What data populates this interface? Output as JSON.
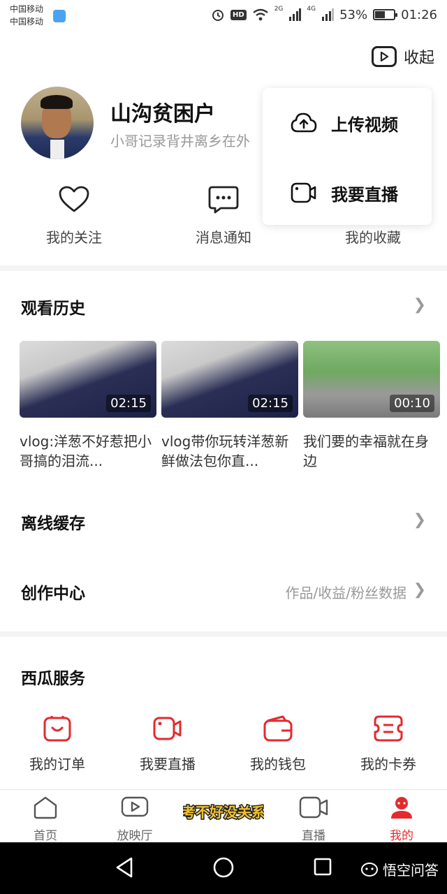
{
  "status_bar": {
    "carrier_1": "中国移动",
    "carrier_2": "中国移动",
    "hd": "HD",
    "net_1": "2G",
    "net_2": "4G",
    "battery": "53%",
    "battery_level": 0.53,
    "time": "01:26"
  },
  "header": {
    "collapse_label": "收起"
  },
  "profile": {
    "name": "山沟贫困户",
    "bio": "小哥记录背井离乡在外"
  },
  "popup_menu": {
    "upload": "上传视频",
    "live": "我要直播"
  },
  "quick_actions": [
    {
      "label": "我的关注",
      "icon": "heart-icon"
    },
    {
      "label": "消息通知",
      "icon": "message-icon"
    },
    {
      "label": "我的收藏",
      "icon": "star-icon"
    }
  ],
  "history": {
    "title": "观看历史",
    "items": [
      {
        "title": "vlog:洋葱不好惹把小哥搞的泪流...",
        "duration": "02:15"
      },
      {
        "title": "vlog带你玩转洋葱新鲜做法包你直...",
        "duration": "02:15"
      },
      {
        "title": "我们要的幸福就在身边",
        "duration": "00:10"
      }
    ]
  },
  "offline": {
    "title": "离线缓存"
  },
  "creator": {
    "title": "创作中心",
    "subtitle": "作品/收益/粉丝数据"
  },
  "services": {
    "title": "西瓜服务",
    "accent": "#e32a2e",
    "items": [
      {
        "label": "我的订单",
        "icon": "order-icon"
      },
      {
        "label": "我要直播",
        "icon": "live-camera-icon"
      },
      {
        "label": "我的钱包",
        "icon": "wallet-icon"
      },
      {
        "label": "我的卡券",
        "icon": "coupon-icon"
      }
    ]
  },
  "tabbar": {
    "items": [
      {
        "label": "首页",
        "icon": "home-icon",
        "active": false
      },
      {
        "label": "放映厅",
        "icon": "theater-icon",
        "active": false
      },
      {
        "label": "直播",
        "icon": "camera-icon",
        "active": false
      },
      {
        "label": "我的",
        "icon": "profile-icon",
        "active": true
      }
    ],
    "promo_text": "考不好没关系"
  },
  "system_nav": {
    "watermark": "悟空问答"
  }
}
